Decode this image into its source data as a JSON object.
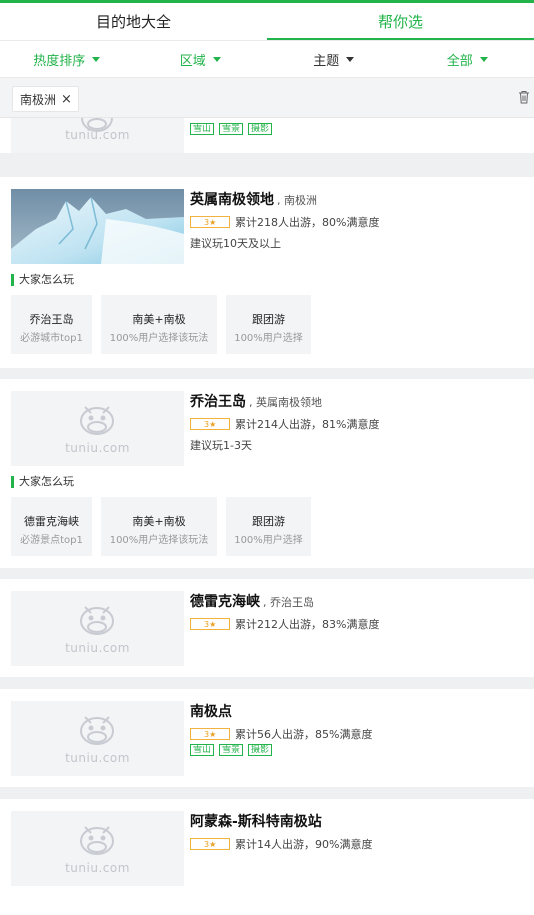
{
  "tabs": [
    {
      "label": "目的地大全",
      "active": false
    },
    {
      "label": "帮你选",
      "active": true
    }
  ],
  "filters": [
    {
      "label": "热度排序",
      "active": true
    },
    {
      "label": "区域",
      "active": true
    },
    {
      "label": "主题",
      "active": false
    },
    {
      "label": "全部",
      "active": true
    }
  ],
  "selected_tag": {
    "label": "南极洲",
    "close": "×"
  },
  "watermark": "tuniu.com",
  "level_text": "3★",
  "section_label": "大家怎么玩",
  "partial_card": {
    "tags": [
      "雪山",
      "雪景",
      "摄影"
    ]
  },
  "cards": [
    {
      "name": "英属南极领地",
      "region": ", 南极洲",
      "stats": "累计218人出游，80%满意度",
      "hint": "建议玩10天及以上",
      "plays": [
        {
          "title": "乔治王岛",
          "sub": "必游城市top1"
        },
        {
          "title": "南美+南极",
          "sub": "100%用户选择该玩法"
        },
        {
          "title": "跟团游",
          "sub": "100%用户选择"
        }
      ]
    },
    {
      "name": "乔治王岛",
      "region": ", 英属南极领地",
      "stats": "累计214人出游，81%满意度",
      "hint": "建议玩1-3天",
      "plays": [
        {
          "title": "德雷克海峡",
          "sub": "必游景点top1"
        },
        {
          "title": "南美+南极",
          "sub": "100%用户选择该玩法"
        },
        {
          "title": "跟团游",
          "sub": "100%用户选择"
        }
      ]
    },
    {
      "name": "德雷克海峡",
      "region": ", 乔治王岛",
      "stats": "累计212人出游，83%满意度"
    },
    {
      "name": "南极点",
      "region": "",
      "stats": "累计56人出游，85%满意度",
      "tags": [
        "雪山",
        "雪景",
        "摄影"
      ]
    },
    {
      "name": "阿蒙森-斯科特南极站",
      "region": "",
      "stats": "累计14人出游，90%满意度"
    }
  ],
  "colors": {
    "accent": "#22b34a",
    "level": "#f3b23d"
  }
}
